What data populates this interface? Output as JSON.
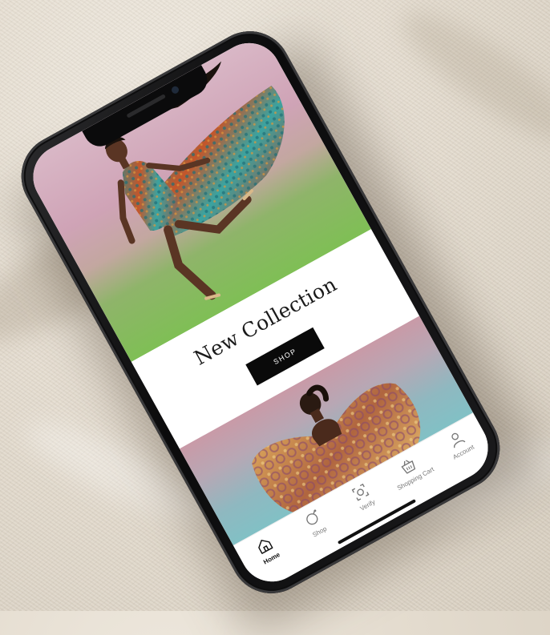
{
  "hero": {
    "image": "fashion-model-print-dress"
  },
  "collection": {
    "title": "New Collection",
    "shop_label": "SHOP"
  },
  "promo": {
    "image": "model-bow-dress"
  },
  "tabbar": {
    "items": [
      {
        "label": "Home",
        "icon": "home-icon",
        "active": true
      },
      {
        "label": "Shop",
        "icon": "shop-icon",
        "active": false
      },
      {
        "label": "Verify",
        "icon": "verify-icon",
        "active": false
      },
      {
        "label": "Shopping Cart",
        "icon": "cart-icon",
        "active": false
      },
      {
        "label": "Account",
        "icon": "account-icon",
        "active": false
      }
    ]
  },
  "colors": {
    "button_bg": "#0a0a0a",
    "screen_bg": "#ffffff",
    "phone_body": "#0b0b0c"
  }
}
